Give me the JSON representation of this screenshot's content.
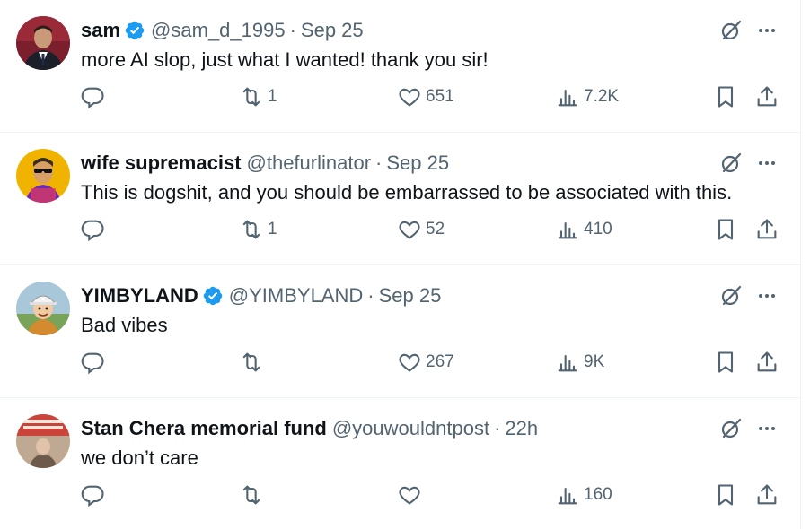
{
  "colors": {
    "verified": "#1d9bf0",
    "secondary_text": "#536471",
    "primary_text": "#0f1419",
    "divider": "#eff3f4"
  },
  "icons": [
    "reply-icon",
    "retweet-icon",
    "like-icon",
    "views-icon",
    "bookmark-icon",
    "share-icon",
    "grok-icon",
    "more-icon",
    "verified-icon"
  ],
  "tweets": [
    {
      "name": "sam",
      "verified": true,
      "handle": "@sam_d_1995",
      "separator": "·",
      "time": "Sep 25",
      "text": "more AI slop, just what I wanted! thank you sir!",
      "replies": "",
      "retweets": "1",
      "likes": "651",
      "views": "7.2K"
    },
    {
      "name": "wife supremacist",
      "verified": false,
      "handle": "@thefurlinator",
      "separator": "·",
      "time": "Sep 25",
      "text": "This is dogshit, and you should be embarrassed to be associated with this.",
      "replies": "",
      "retweets": "1",
      "likes": "52",
      "views": "410"
    },
    {
      "name": "YIMBYLAND",
      "verified": true,
      "handle": "@YIMBYLAND",
      "separator": "·",
      "time": "Sep 25",
      "text": "Bad vibes",
      "replies": "",
      "retweets": "",
      "likes": "267",
      "views": "9K"
    },
    {
      "name": "Stan Chera memorial fund",
      "verified": false,
      "handle": "@youwouldntpost",
      "separator": "·",
      "time": "22h",
      "text": "we don’t care",
      "replies": "",
      "retweets": "",
      "likes": "",
      "views": "160"
    }
  ]
}
